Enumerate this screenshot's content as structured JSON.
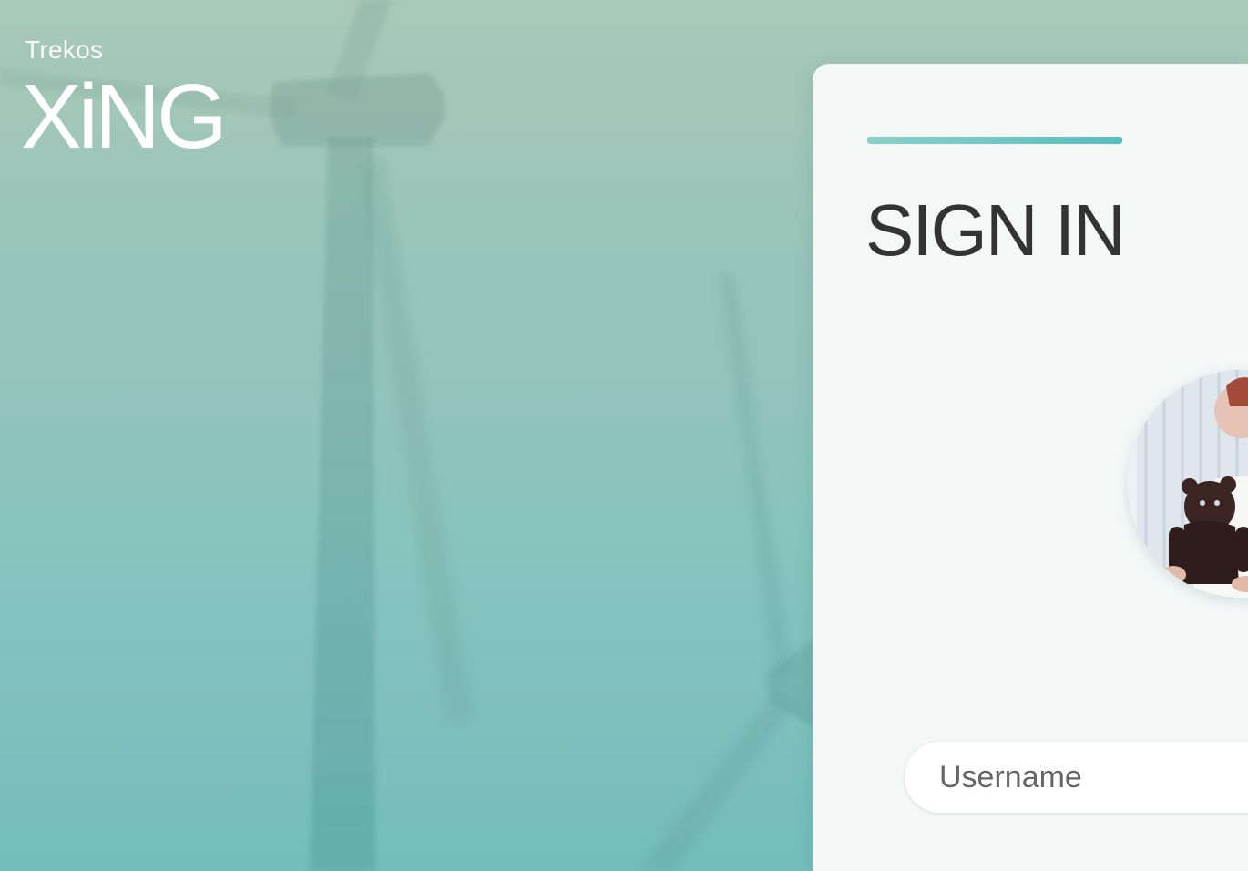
{
  "brand": {
    "small": "Trekos",
    "big": "XiNG"
  },
  "signin": {
    "title": "SIGN IN",
    "username_placeholder": "Username",
    "username_value": ""
  },
  "colors": {
    "accent": "#5bbcbc",
    "accent_light": "#a8d8d4",
    "panel_bg": "#f3f8f7",
    "title_text": "#333333"
  },
  "icons": {
    "avatar": "user-avatar-photo",
    "background": "wind-turbine-illustration"
  }
}
